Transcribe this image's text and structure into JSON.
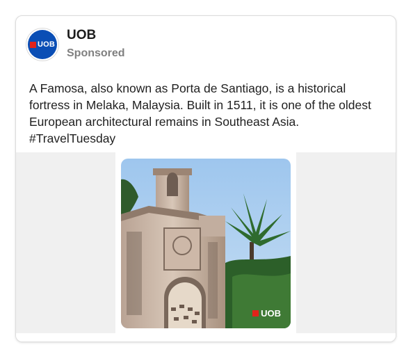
{
  "post": {
    "brand": "UOB",
    "sponsored_label": "Sponsored",
    "avatar_logo_text": "UOB",
    "text": "A Famosa, also known as Porta de Santiago, is a historical fortress in Melaka, Malaysia. Built in 1511, it is one of the oldest European architectural remains in Southeast Asia. #TravelTuesday",
    "image_logo_text": "UOB"
  },
  "colors": {
    "brand_blue": "#0a4eb5",
    "brand_red": "#e2231a",
    "sky": "#a9cdef"
  }
}
